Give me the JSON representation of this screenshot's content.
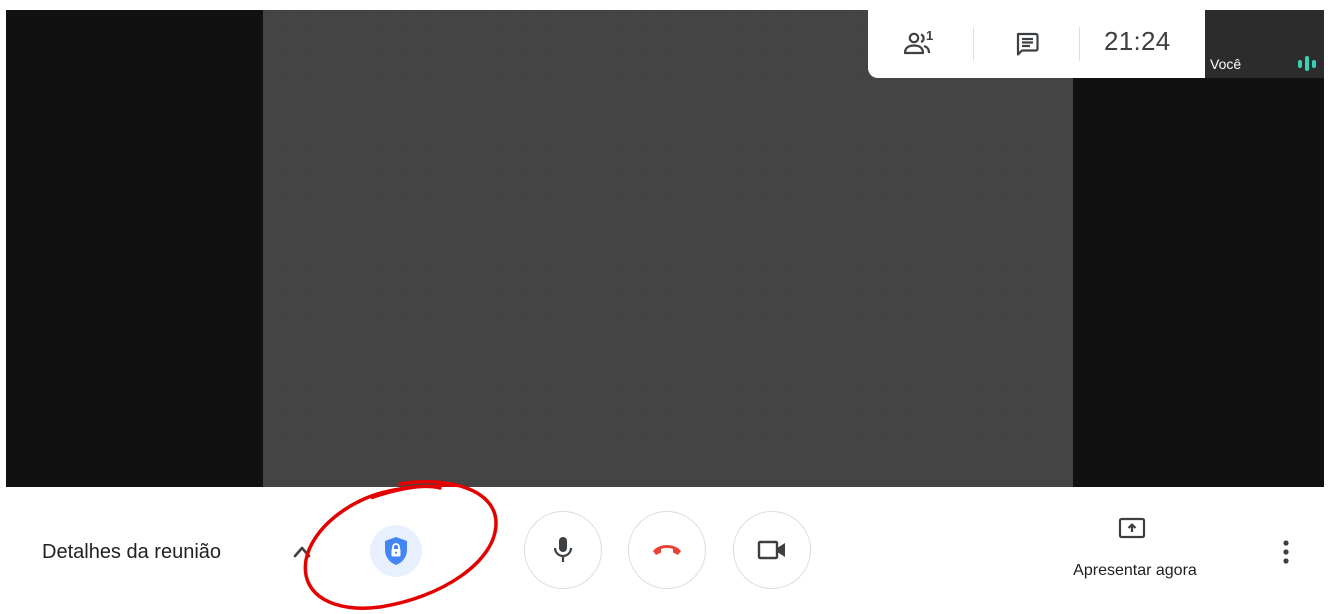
{
  "top_panel": {
    "people_icon": "people-icon",
    "people_count": "1",
    "chat_icon": "chat-icon",
    "time": "21:24"
  },
  "self_tile": {
    "name": "Você",
    "audio_icon": "audio-level-icon"
  },
  "bottom_bar": {
    "meeting_details_label": "Detalhes da reunião",
    "chevron_icon": "chevron-up-icon",
    "shield_icon": "shield-lock-icon",
    "mic_icon": "microphone-icon",
    "hangup_icon": "hangup-icon",
    "camera_icon": "camera-icon",
    "present_icon": "present-screen-icon",
    "present_label": "Apresentar agora",
    "more_icon": "more-vertical-icon"
  },
  "colors": {
    "shield_blue": "#4285f4",
    "shield_bg": "#e8f0fe",
    "hangup_red": "#ea4335",
    "audio_teal": "#3ad1b7",
    "annotation_red": "#e50000"
  }
}
